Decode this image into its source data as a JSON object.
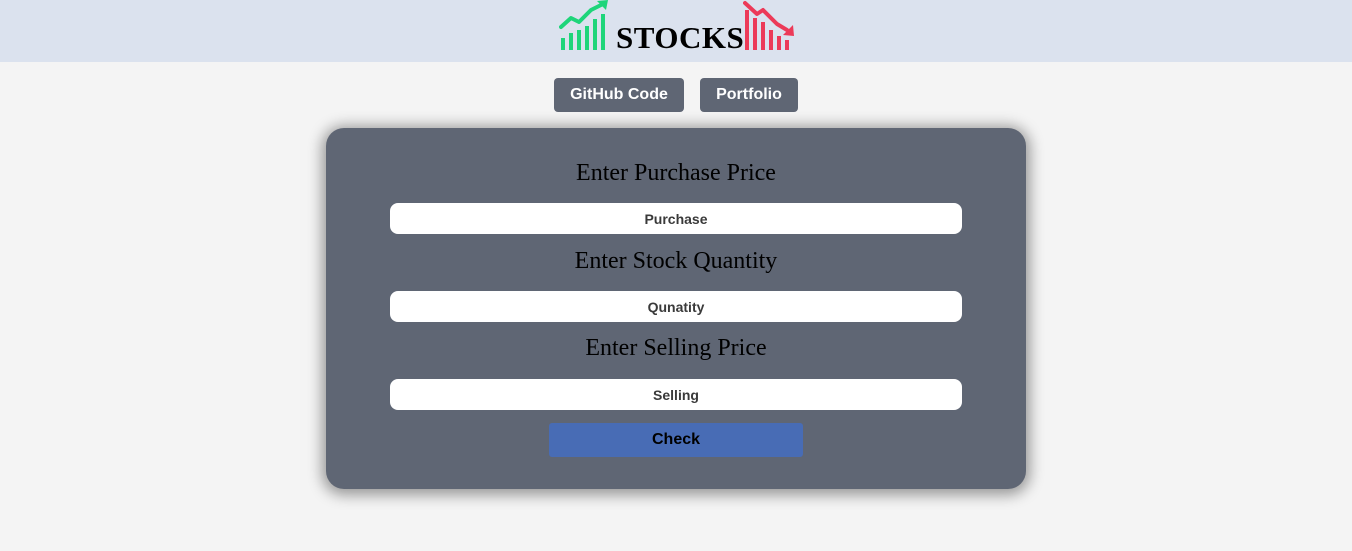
{
  "header": {
    "logo_text": "STOCKS",
    "logo_up_icon": "chart-up-icon",
    "logo_down_icon": "chart-down-icon",
    "up_color": "#1ed57a",
    "down_color": "#ec3a58",
    "background": "#dbe2ee"
  },
  "nav": {
    "github_label": "GitHub Code",
    "portfolio_label": "Portfolio"
  },
  "form": {
    "purchase_label": "Enter Purchase Price",
    "purchase_placeholder": "Purchase",
    "quantity_label": "Enter Stock Quantity",
    "quantity_placeholder": "Qunatity",
    "selling_label": "Enter Selling Price",
    "selling_placeholder": "Selling",
    "check_label": "Check"
  },
  "colors": {
    "card": "#5f6674",
    "button": "#5f6674",
    "check_button": "#486cb5",
    "page_background": "#f4f4f4"
  }
}
